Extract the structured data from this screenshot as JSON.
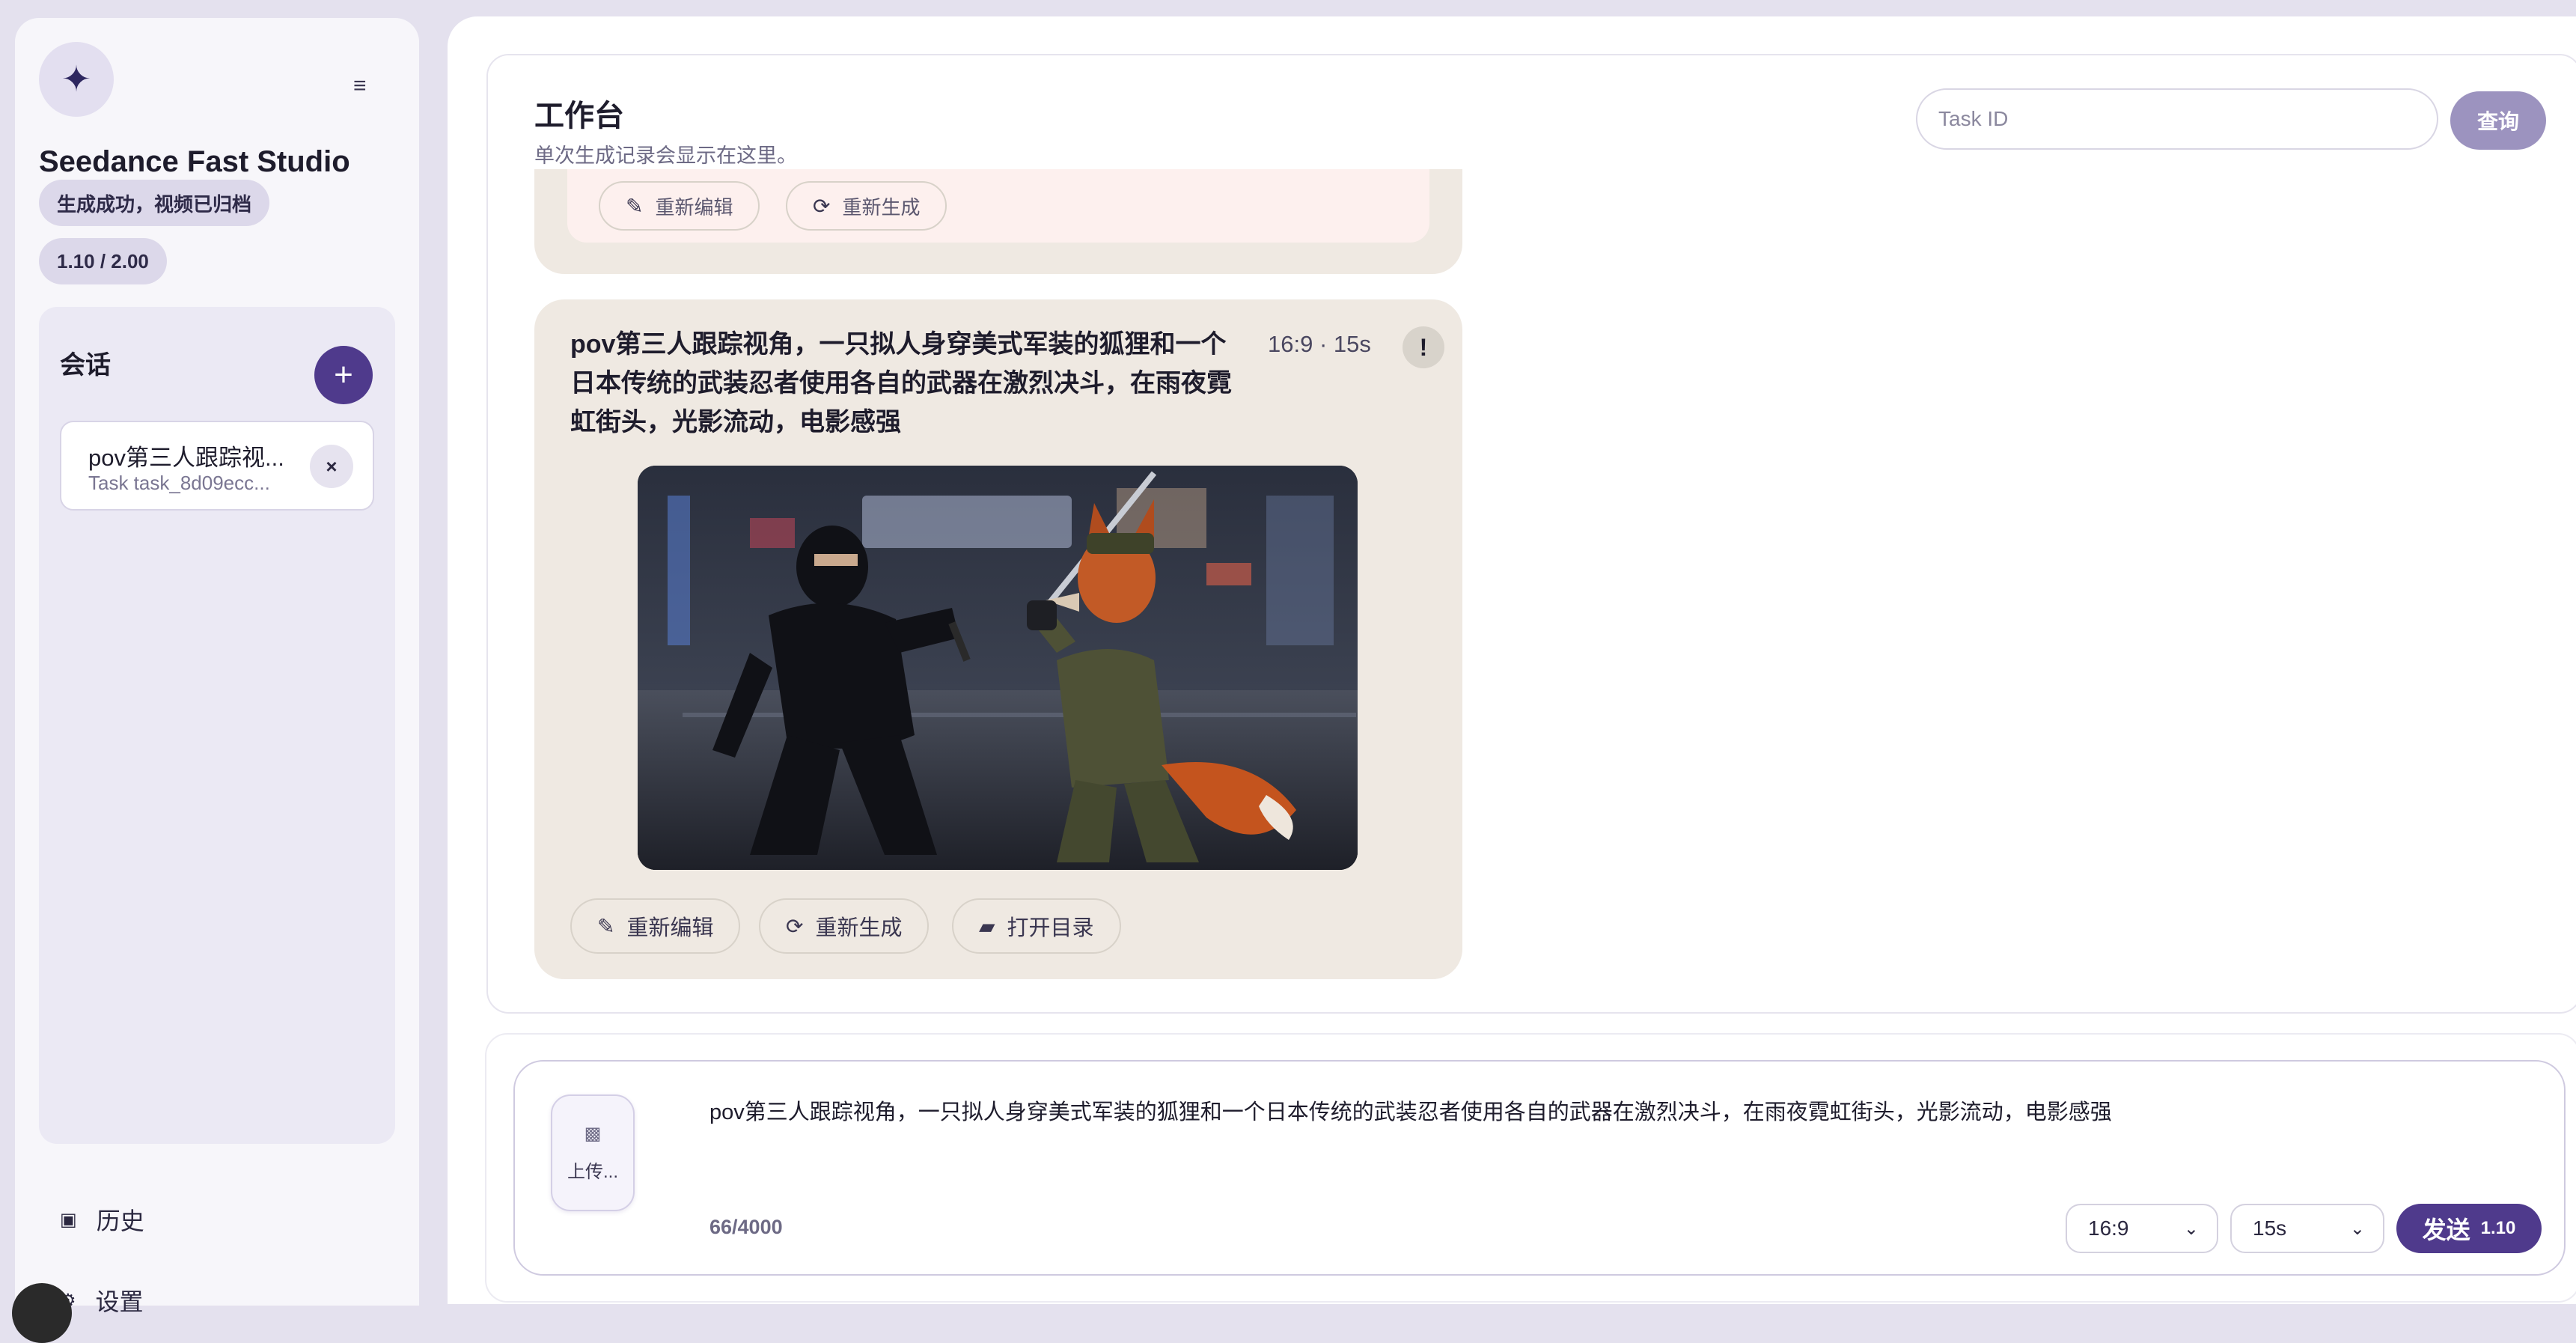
{
  "sidebar": {
    "logo_icon": "sparkle-icon",
    "menu_icon": "≡",
    "app_title": "Seedance Fast Studio",
    "status_pill": "生成成功，视频已归档",
    "credits_pill": "1.10 / 2.00",
    "sessions": {
      "title": "会话",
      "add_icon": "+",
      "items": [
        {
          "title": "pov第三人跟踪视...",
          "subtitle": "Task task_8d09ecc...",
          "close_icon": "×"
        }
      ]
    },
    "nav": {
      "history_icon": "▣",
      "history": "历史",
      "settings_icon": "⚙",
      "settings": "设置"
    }
  },
  "workspace": {
    "title": "工作台",
    "subtitle": "单次生成记录会显示在这里。",
    "task_input_placeholder": "Task ID",
    "query_label": "查询"
  },
  "previous_card": {
    "edit_icon": "✎",
    "edit_label": "重新编辑",
    "regen_icon": "⟳",
    "regen_label": "重新生成"
  },
  "card": {
    "prompt": "pov第三人跟踪视角，一只拟人身穿美式军装的狐狸和一个日本传统的武装忍者使用各自的武器在激烈决斗，在雨夜霓虹街头，光影流动，电影感强",
    "meta": "16:9 · 15s",
    "warn_icon": "!",
    "edit_icon": "✎",
    "edit_label": "重新编辑",
    "regen_icon": "⟳",
    "regen_label": "重新生成",
    "folder_icon": "▰",
    "folder_label": "打开目录"
  },
  "composer": {
    "upload_icon": "▩",
    "upload_label": "上传...",
    "prompt_value": "pov第三人跟踪视角，一只拟人身穿美式军装的狐狸和一个日本传统的武装忍者使用各自的武器在激烈决斗，在雨夜霓虹街头，光影流动，电影感强",
    "char_count": "66/4000",
    "ratio": "16:9",
    "duration": "15s",
    "chevron": "⌄",
    "send_label": "发送",
    "send_cost": "1.10"
  },
  "colors": {
    "accent": "#4f3a8c",
    "accent_muted": "#9c93bf",
    "card_bg": "#efe9e2",
    "sidebar_bg": "#f7f6fa"
  }
}
